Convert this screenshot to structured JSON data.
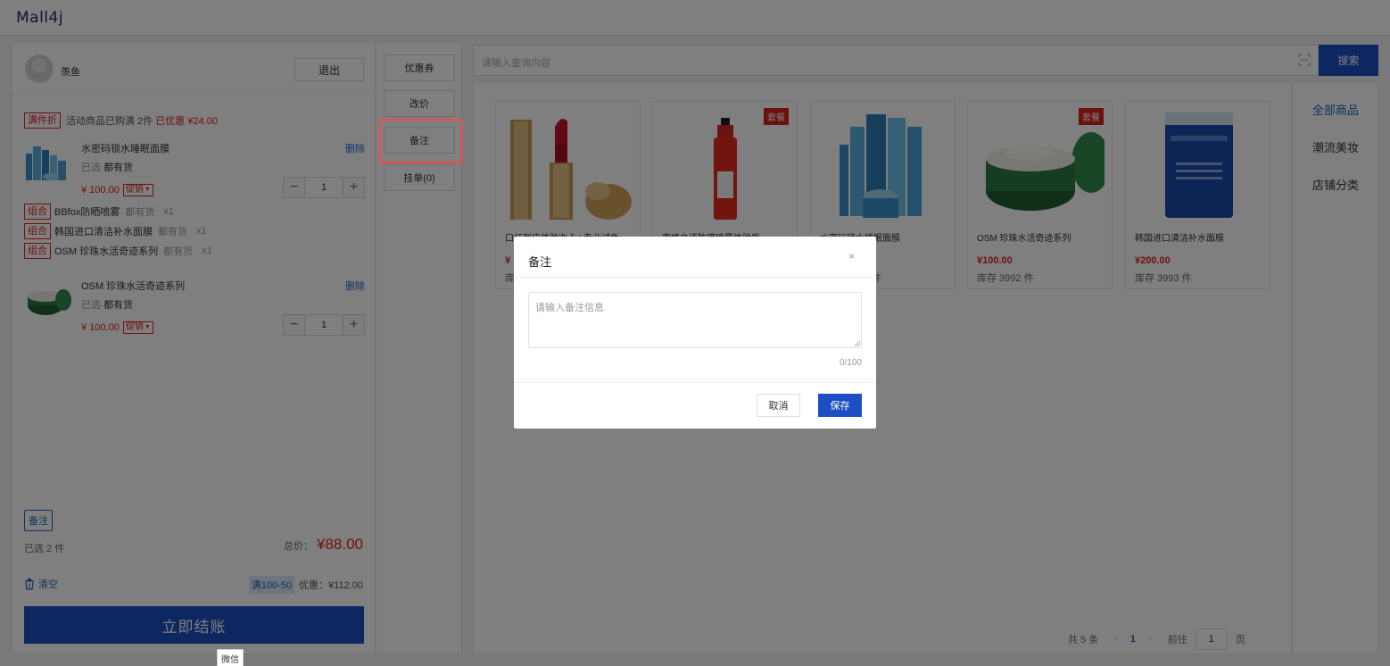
{
  "app": {
    "logo": "Mall4j"
  },
  "user": {
    "name": "羡鱼",
    "logout": "退出"
  },
  "cart": {
    "promo": {
      "tag": "满件折",
      "text": "活动商品已购满 2件",
      "discount_text": "已优惠 ¥24.00"
    },
    "items": [
      {
        "name": "水密码锁水睡眠面膜",
        "spec_label": "已选",
        "spec_value": "都有货",
        "delete": "删除",
        "price": "¥ 100.00",
        "promo_tag": "促销",
        "qty": "1"
      },
      {
        "name": "OSM 珍珠水活奇迹系列",
        "spec_label": "已选",
        "spec_value": "都有货",
        "delete": "删除",
        "price": "¥ 100.00",
        "promo_tag": "促销",
        "qty": "1"
      }
    ],
    "combos": [
      {
        "tag": "组合",
        "name": "BBfox防晒喷雾",
        "stock": "都有货",
        "qty": "x1"
      },
      {
        "tag": "组合",
        "name": "韩国进口清洁补水面膜",
        "stock": "都有货",
        "qty": "x1"
      },
      {
        "tag": "组合",
        "name": "OSM 珍珠水活奇迹系列",
        "stock": "都有货",
        "qty": "x1"
      }
    ],
    "remark_tag": "备注",
    "selected_count": "已选 2 件",
    "total_label": "总价：",
    "total_amount": "¥88.00",
    "clear": "清空",
    "discount_tag": "满100-50",
    "discount_text": "优惠：¥112.00",
    "checkout": "立即结账"
  },
  "actions": [
    "优惠券",
    "改价",
    "备注",
    "挂单(0)"
  ],
  "search": {
    "placeholder": "请输入查询内容",
    "button": "搜索"
  },
  "products": [
    {
      "title": "口红到店体验次卡 | 专业试色",
      "price": "¥",
      "stock": "库",
      "set_tag": ""
    },
    {
      "title": "蜜蜂之语防晒喷雾体验瓶",
      "price": "",
      "stock": "",
      "set_tag": "套餐"
    },
    {
      "title": "水密码锁水睡眠面膜",
      "price": "",
      "stock": "件",
      "set_tag": ""
    },
    {
      "title": "OSM 珍珠水活奇迹系列",
      "price": "¥100.00",
      "stock": "库存 3992 件",
      "set_tag": "套餐"
    },
    {
      "title": "韩国进口清洁补水面膜",
      "price": "¥200.00",
      "stock": "库存 3993 件",
      "set_tag": ""
    }
  ],
  "pagination": {
    "total": "共 5 条",
    "current": "1",
    "goto_label": "前往",
    "goto_value": "1",
    "page_suffix": "页"
  },
  "categories": [
    "全部商品",
    "潮流美妆",
    "店铺分类"
  ],
  "modal": {
    "title": "备注",
    "close": "×",
    "placeholder": "请输入备注信息",
    "counter": "0/100",
    "cancel": "取消",
    "save": "保存"
  },
  "tooltip": "微信",
  "colors": {
    "primary": "#1b4fc3",
    "danger": "#e02020",
    "link": "#1e63c4"
  }
}
